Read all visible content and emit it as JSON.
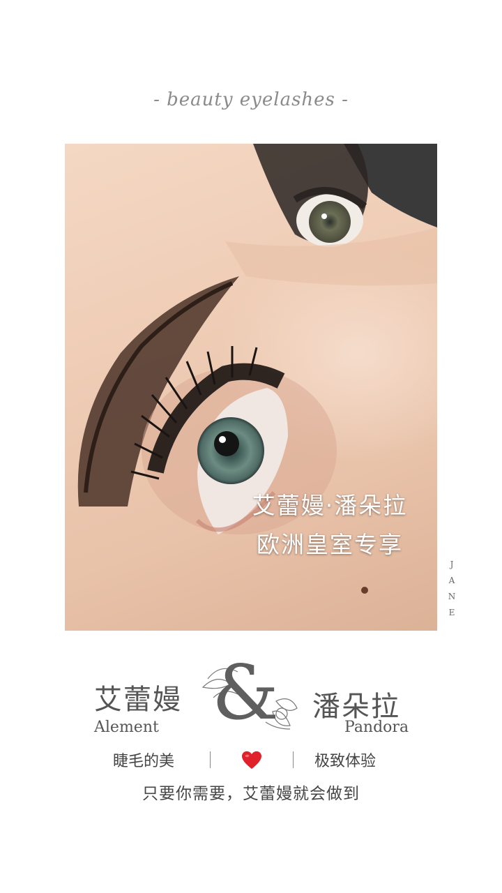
{
  "header": {
    "tagline": "- beauty eyelashes -"
  },
  "photo": {
    "overlay_line1": "艾蕾嫚·潘朵拉",
    "overlay_line2": "欧洲皇室专享"
  },
  "side_vertical_text": "J A N E",
  "brands": {
    "left_cn": "艾蕾嫚",
    "left_en": "Alement",
    "ampersand": "&",
    "right_cn": "潘朵拉",
    "right_en": "Pandora"
  },
  "features": {
    "left": "睫毛的美",
    "heart_icon": "heart-icon",
    "right": "极致体验"
  },
  "slogan": "只要你需要，艾蕾嫚就会做到",
  "colors": {
    "background": "#ffffff",
    "text": "#555555",
    "heart": "#e0202a"
  }
}
